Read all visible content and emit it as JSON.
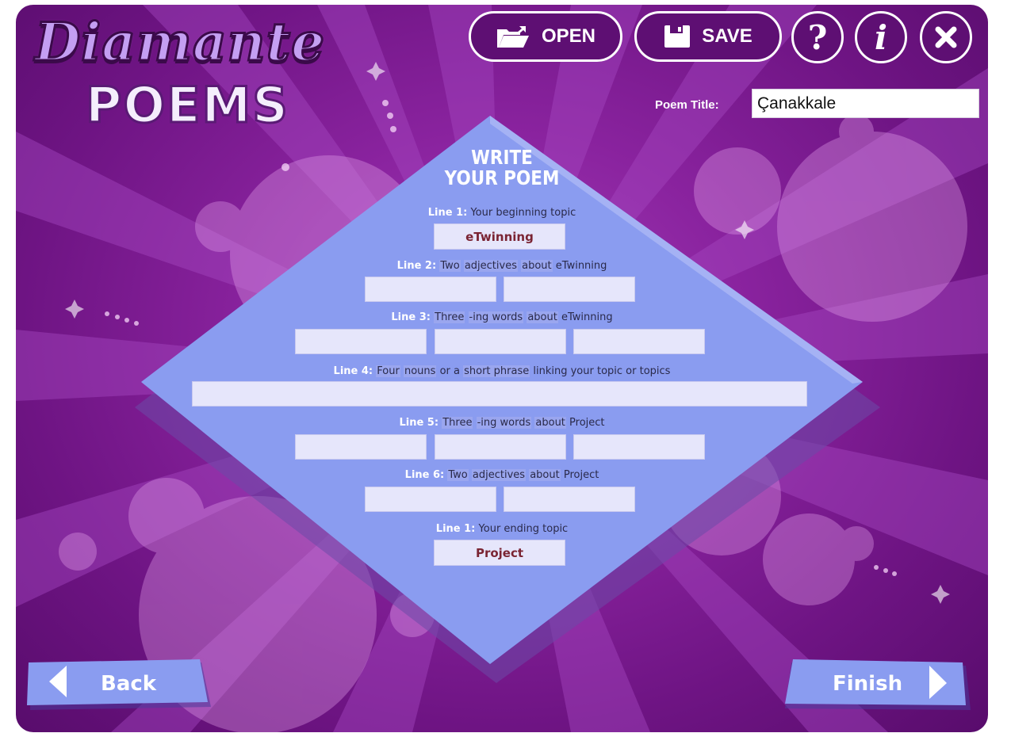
{
  "app": {
    "logo_line1": "Diamante",
    "logo_line2": "POEMS"
  },
  "toolbar": {
    "open_label": "OPEN",
    "save_label": "SAVE",
    "help_label": "?",
    "info_label": "i"
  },
  "poem_title": {
    "label": "Poem Title:",
    "value": "Çanakkale"
  },
  "form": {
    "heading_line1": "WRITE",
    "heading_line2": "YOUR POEM",
    "line1": {
      "num": "Line 1:",
      "text": "Your beginning topic",
      "value": "eTwinning"
    },
    "line2": {
      "num": "Line 2:",
      "w1": "Two",
      "w2": "adjectives",
      "w3": "about",
      "w4": "eTwinning"
    },
    "line3": {
      "num": "Line 3:",
      "w1": "Three",
      "w2": "-ing words",
      "w3": "about",
      "w4": "eTwinning"
    },
    "line4": {
      "num": "Line 4:",
      "w1": "Four",
      "w2": "nouns",
      "w3": "or a",
      "w4": "short phrase",
      "w5": "linking your topic or topics"
    },
    "line5": {
      "num": "Line 5:",
      "w1": "Three",
      "w2": "-ing words",
      "w3": "about",
      "w4": "Project"
    },
    "line6": {
      "num": "Line 6:",
      "w1": "Two",
      "w2": "adjectives",
      "w3": "about",
      "w4": "Project"
    },
    "line7": {
      "num": "Line 1:",
      "text": "Your ending topic",
      "value": "Project"
    }
  },
  "nav": {
    "back_label": "Back",
    "finish_label": "Finish"
  },
  "colors": {
    "background": "#7d1b93",
    "diamond": "#8a9cf0",
    "input": "#e6e6fb",
    "nav_button": "#8a9cf0",
    "topic_text": "#7a2433"
  },
  "icons": [
    "folder-icon",
    "floppy-disk-icon",
    "help-icon",
    "info-icon",
    "close-icon",
    "arrow-left-icon",
    "arrow-right-icon"
  ]
}
